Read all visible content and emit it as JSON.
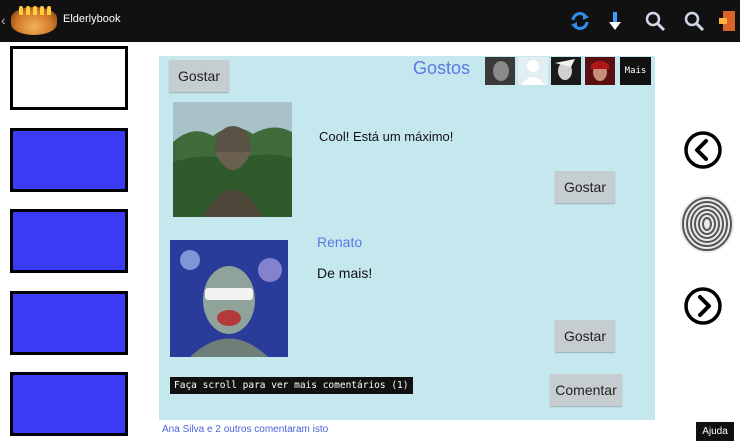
{
  "app": {
    "title": "Elderlybook"
  },
  "actionbar": {
    "icons": [
      "refresh-icon",
      "download-icon",
      "zoom-in-icon",
      "zoom-out-icon",
      "exit-icon"
    ]
  },
  "post": {
    "like_button": "Gostar",
    "likes_title": "Gostos",
    "likers_more": "Mais",
    "comments": [
      {
        "author": "",
        "text": "Cool! Está um máximo!",
        "like_button": "Gostar"
      },
      {
        "author": "Renato",
        "text": "De mais!",
        "like_button": "Gostar"
      }
    ],
    "scroll_hint": "Faça scroll para ver mais comentários (1)",
    "comment_button": "Comentar",
    "summary": "Ana Silva e 2 outros comentaram isto"
  },
  "help_button": "Ajuda",
  "colors": {
    "panel_bg": "#c5e8ef",
    "accent_text": "#5b78e4",
    "tile_blue": "#3b3bf6",
    "actionbar_bg": "#111111",
    "button_bg": "#c6cdd0"
  }
}
